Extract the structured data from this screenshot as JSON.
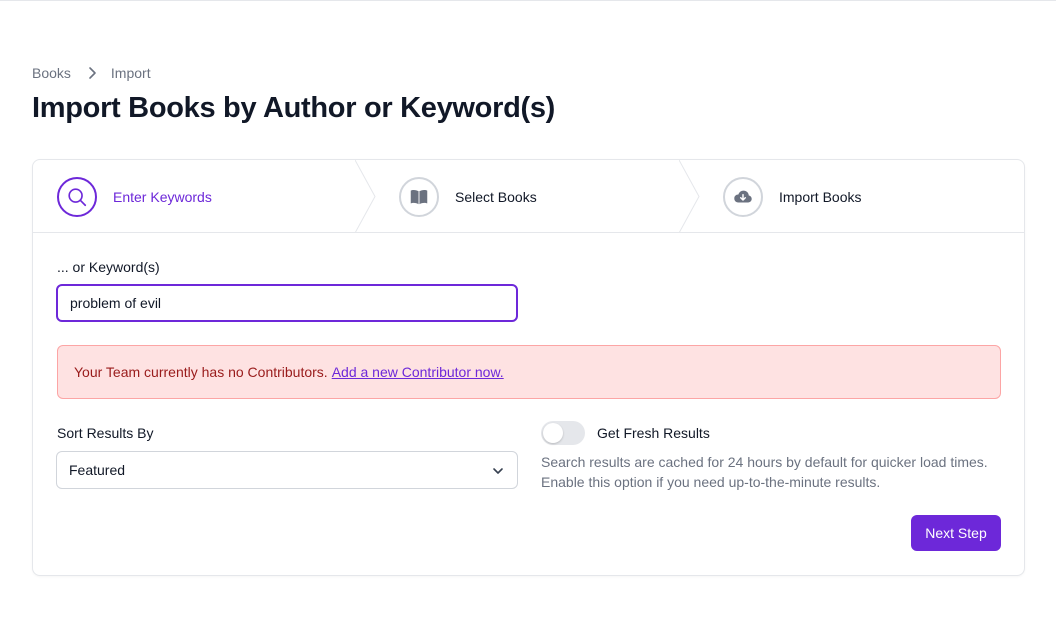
{
  "breadcrumb": {
    "items": [
      "Books",
      "Import"
    ]
  },
  "page_title": "Import Books by Author or Keyword(s)",
  "steps": [
    {
      "label": "Enter Keywords",
      "icon": "search-icon",
      "state": "current"
    },
    {
      "label": "Select Books",
      "icon": "book-open-icon",
      "state": "upcoming"
    },
    {
      "label": "Import Books",
      "icon": "cloud-download-icon",
      "state": "upcoming"
    }
  ],
  "keyword": {
    "label": "... or Keyword(s)",
    "value": "problem of evil"
  },
  "alert": {
    "text": "Your Team currently has no Contributors.",
    "link": "Add a new Contributor now."
  },
  "sort": {
    "label": "Sort Results By",
    "value": "Featured"
  },
  "fresh": {
    "label": "Get Fresh Results",
    "enabled": false,
    "help": "Search results are cached for 24 hours by default for quicker load times. Enable this option if you need up-to-the-minute results."
  },
  "next_button": "Next Step",
  "colors": {
    "accent": "#6d28d9",
    "alert_bg": "#fee2e2",
    "alert_text": "#991b1b"
  }
}
